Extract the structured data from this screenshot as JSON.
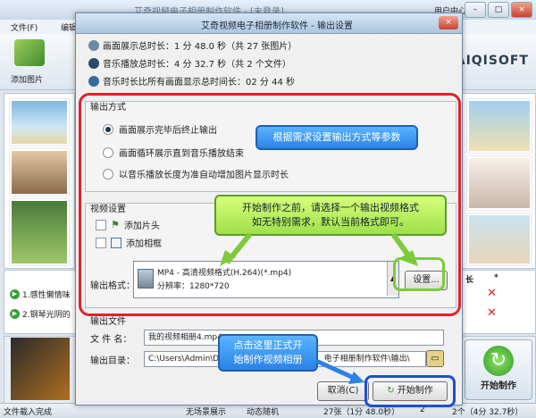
{
  "main": {
    "title": "艾奇视频电子相册制作软件 - [未登录]",
    "user_center": "用户中心",
    "menu": [
      "文件(F)",
      "编辑"
    ],
    "toolbar_add_photo": "添加图片",
    "brand": "AIQISOFT",
    "music_list": {
      "col_length": "长",
      "col_star": "*",
      "items": [
        "1.感性懒情味",
        "2.钢琴光阴的"
      ]
    },
    "start_button": "开始制作",
    "status": {
      "loaded": "文件载入完成",
      "transitions": "无场景展示",
      "animations": "动态随机",
      "counts": "27张（1分 48.0秒）",
      "music": "2个（4分 32.7秒）",
      "slot1": "2"
    }
  },
  "dialog": {
    "title": "艾奇视频电子相册制作软件 - 输出设置",
    "close": "×",
    "info": {
      "photo_duration": "画面展示总时长：1 分 48.0 秒（共 27 张图片）",
      "music_duration": "音乐播放总时长：4 分 32.7 秒（共 2 个文件）",
      "ratio": "音乐时长比所有画面显示总时间长：02 分 44 秒"
    },
    "output_mode": {
      "label": "输出方式",
      "options": [
        "画面展示完毕后终止输出",
        "画面循环展示直到音乐播放结束",
        "以音乐播放长度为准自动增加图片显示时长"
      ],
      "selected": 0
    },
    "video_settings": {
      "label": "视频设置",
      "add_intro": "添加片头",
      "add_frame": "添加相框",
      "format_label": "输出格式：",
      "format_line1": "MP4 - 高清视频格式(H.264)(*.mp4)",
      "format_line2": "分辨率：1280*720",
      "settings_button": "设置..."
    },
    "output_file": {
      "label": "输出文件",
      "filename_label": "文 件 名：",
      "filename_value": "我的视频相册4.mp4",
      "dir_label": "输出目录：",
      "dir_value": "C:\\Users\\Admin\\Doc",
      "dir_value_tail": "电子相册制作软件\\输出\\"
    },
    "cancel_button": "取消(C)",
    "start_button": "开始制作"
  },
  "annotations": {
    "bubble1": "根据需求设置输出方式等参数",
    "bubble2_line1": "开始制作之前，请选择一个输出视频格式",
    "bubble2_line2": "如无特别需求，默认当前格式即可。",
    "bubble3_line1": "点击这里正式开",
    "bubble3_line2": "始制作视频相册"
  },
  "colors": {
    "annotation_red": "#e0222c",
    "bubble_blue": "#2a82e6",
    "bubble_green": "#9ee04a",
    "start_green": "#2f9a1d"
  }
}
